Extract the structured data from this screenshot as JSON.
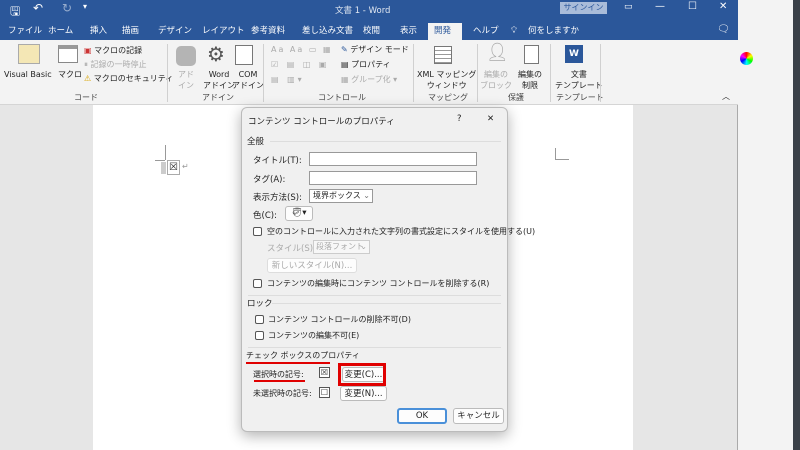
{
  "window": {
    "title": "文書 1 - Word",
    "signin": "サインイン"
  },
  "tabs": [
    "ファイル",
    "ホーム",
    "挿入",
    "描画",
    "デザイン",
    "レイアウト",
    "参考資料",
    "差し込み文書",
    "校閲",
    "表示",
    "開発",
    "ヘルプ"
  ],
  "selected_tab": "開発",
  "tell_me": "何をしますか",
  "ribbon": {
    "code": {
      "label": "コード",
      "visual_basic": "Visual Basic",
      "macro": "マクロ",
      "record": "マクロの記録",
      "pause": "記録の一時停止",
      "security": "マクロのセキュリティ"
    },
    "addins": {
      "label": "アドイン",
      "addin": "アド\nイン",
      "word_addin": "Word\nアドイン",
      "com_addin": "COM\nアドイン"
    },
    "controls": {
      "label": "コントロール",
      "design_mode": "デザイン モード",
      "properties": "プロパティ",
      "group": "グループ化"
    },
    "mapping": {
      "label": "マッピング",
      "xml": "XML マッピング\nウィンドウ"
    },
    "protect": {
      "label": "保護",
      "block": "編集の\nブロック",
      "restrict": "編集の\n制限"
    },
    "template": {
      "label": "テンプレート",
      "doc_template": "文書\nテンプレート"
    }
  },
  "dialog": {
    "title": "コンテンツ コントロールのプロパティ",
    "help": "?",
    "close": "✕",
    "general": "全般",
    "title_label": "タイトル(T):",
    "title_value": "",
    "tag_label": "タグ(A):",
    "tag_value": "",
    "show_label": "表示方法(S):",
    "show_value": "境界ボックス",
    "color_label": "色(C):",
    "use_style": "空のコントロールに入力された文字列の書式設定にスタイルを使用する(U)",
    "style_label": "スタイル(S):",
    "style_value": "段落フォント",
    "new_style": "新しいスタイル(N)...",
    "remove_on_edit": "コンテンツの編集時にコンテンツ コントロールを削除する(R)",
    "lock": "ロック",
    "no_delete": "コンテンツ コントロールの削除不可(D)",
    "no_edit": "コンテンツの編集不可(E)",
    "checkbox_props": "チェック ボックスのプロパティ",
    "checked_label": "選択時の記号:",
    "checked_symbol": "☒",
    "change_checked": "変更(C)...",
    "unchecked_label": "未選択時の記号:",
    "unchecked_symbol": "☐",
    "change_unchecked": "変更(N)...",
    "ok": "OK",
    "cancel": "キャンセル"
  },
  "doc": {
    "checkbox": "☒"
  }
}
